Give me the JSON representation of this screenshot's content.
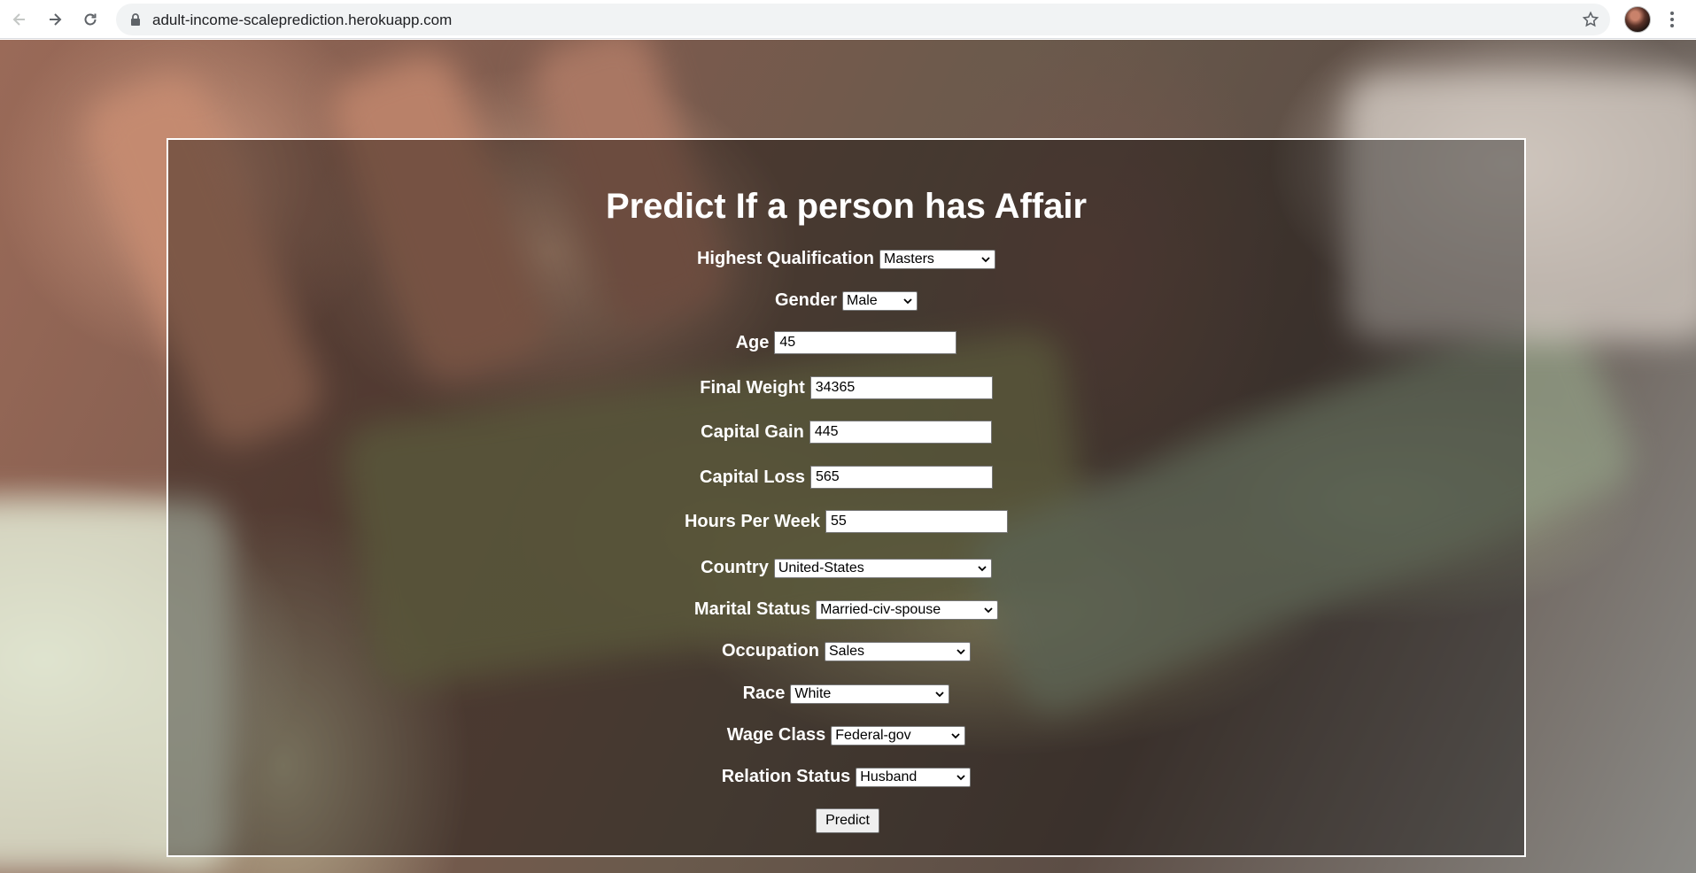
{
  "browser": {
    "url": "adult-income-scaleprediction.herokuapp.com"
  },
  "form": {
    "title": "Predict If a person has Affair",
    "fields": [
      {
        "label": "Highest Qualification",
        "value": "Masters",
        "kind": "select"
      },
      {
        "label": "Gender",
        "value": "Male",
        "kind": "select"
      },
      {
        "label": "Age",
        "value": "45",
        "kind": "input"
      },
      {
        "label": "Final Weight",
        "value": "34365",
        "kind": "input"
      },
      {
        "label": "Capital Gain",
        "value": "445",
        "kind": "input"
      },
      {
        "label": "Capital Loss",
        "value": "565",
        "kind": "input"
      },
      {
        "label": "Hours Per Week",
        "value": "55",
        "kind": "input"
      },
      {
        "label": "Country",
        "value": "United-States",
        "kind": "select"
      },
      {
        "label": "Marital Status",
        "value": "Married-civ-spouse",
        "kind": "select"
      },
      {
        "label": "Occupation",
        "value": "Sales",
        "kind": "select"
      },
      {
        "label": "Race",
        "value": "White",
        "kind": "select"
      },
      {
        "label": "Wage Class",
        "value": "Federal-gov",
        "kind": "select"
      },
      {
        "label": "Relation Status",
        "value": "Husband",
        "kind": "select"
      }
    ],
    "submit_label": "Predict"
  },
  "colors": {
    "panel_border": "#ffffff",
    "label_text": "#ffffff",
    "omnibox_bg": "#f1f3f4"
  }
}
